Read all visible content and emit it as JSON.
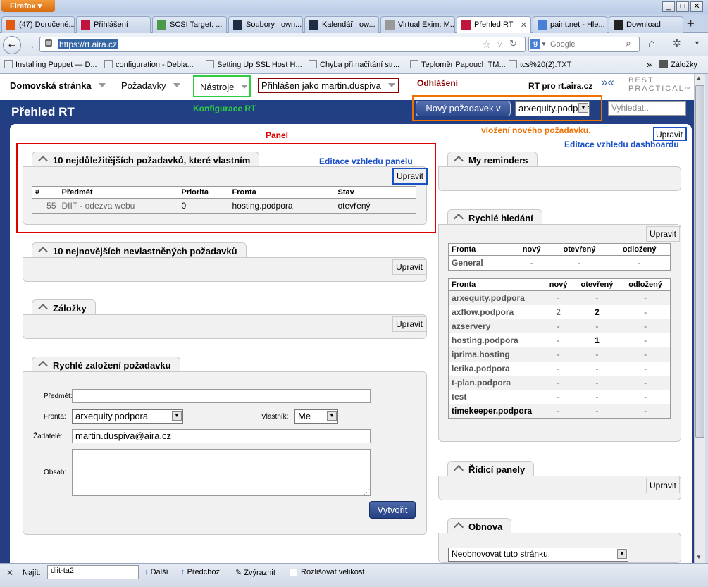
{
  "browser": {
    "menu_button": "Firefox",
    "window_buttons": [
      "_",
      "□",
      "✕"
    ],
    "tabs": [
      {
        "label": "(47) Doručené...",
        "icon": "mail-icon",
        "color": "#e05a14"
      },
      {
        "label": "Přihlášení",
        "icon": "check-icon",
        "color": "#c0143c"
      },
      {
        "label": "SCSI Target: ...",
        "icon": "gear-icon",
        "color": "#4a9a4a"
      },
      {
        "label": "Soubory | own...",
        "icon": "cloud-icon",
        "color": "#1d2d44"
      },
      {
        "label": "Kalendář | ow...",
        "icon": "cloud-icon",
        "color": "#1d2d44"
      },
      {
        "label": "Virtual Exim: M...",
        "icon": "blank-icon",
        "color": "#999999"
      },
      {
        "label": "Přehled RT",
        "icon": "check-icon",
        "color": "#c0143c",
        "active": true
      },
      {
        "label": "paint.net - Hle...",
        "icon": "google-icon",
        "color": "#4a7fd8"
      },
      {
        "label": "Download",
        "icon": "dot-icon",
        "color": "#222222"
      }
    ],
    "new_tab": "+",
    "url": "https://rt.aira.cz",
    "search_placeholder": "Google",
    "bookmarks": [
      {
        "label": "Installing Puppet — D...",
        "icon": "puppet-icon"
      },
      {
        "label": "configuration - Debia...",
        "icon": "debian-icon"
      },
      {
        "label": "Setting Up SSL Host H...",
        "icon": "wiki-icon"
      },
      {
        "label": "Chyba při načítání str...",
        "icon": "blank-icon"
      },
      {
        "label": "Teploměr Papouch TM...",
        "icon": "thermo-icon"
      },
      {
        "label": "tcs%20(2).TXT",
        "icon": "blank-icon"
      }
    ],
    "bookmarks_more": "»",
    "bookmarks_folder": "Záložky"
  },
  "rt": {
    "nav": {
      "home": "Domovská stránka",
      "tickets": "Požadavky",
      "tools": "Nástroje",
      "logged_in": "Přihlášen jako martin.duspiva"
    },
    "brand": "RT pro rt.aira.cz",
    "logo_line1": "BEST",
    "logo_line2": "PRACTICAL",
    "logo_tm": "™",
    "page_title": "Přehled RT",
    "new_ticket_button": "Nový požadavek v",
    "new_ticket_queue": "arxequity.podpora",
    "search_placeholder": "Vyhledat...",
    "dashboard_edit": "Upravit"
  },
  "annotations": {
    "logout": "Odhlášení",
    "rt_config": "Konfigurace RT",
    "panel": "Panel",
    "new_ticket": "vložení nového požadavku.",
    "dashboard_edit": "Editace vzhledu dashboardu",
    "panel_edit": "Editace vzhledu panelu"
  },
  "colors": {
    "logout_red": "#8b0000",
    "config_green": "#2ecc40",
    "panel_red": "#e00000",
    "orange": "#f07000",
    "blue_note": "#1a4fc8",
    "rt_blue": "#253e82"
  },
  "boxes": {
    "my_tickets": {
      "title": "10 nejdůležitějších požadavků, které vlastním",
      "edit": "Upravit",
      "columns": [
        "#",
        "Předmět",
        "Priorita",
        "Fronta",
        "Stav"
      ],
      "rows": [
        [
          "55",
          "DIIT - odezva webu",
          "0",
          "hosting.podpora",
          "otevřený"
        ]
      ]
    },
    "unowned": {
      "title": "10 nejnovějších nevlastněných požadavků",
      "edit": "Upravit"
    },
    "bookmarks": {
      "title": "Záložky",
      "edit": "Upravit"
    },
    "quick_create": {
      "title": "Rychlé založení požadavku",
      "subject_label": "Předmět:",
      "subject_value": "",
      "queue_label": "Fronta:",
      "queue_value": "arxequity.podpora",
      "owner_label": "Vlastník:",
      "owner_value": "Me",
      "requestors_label": "Žadatelé:",
      "requestors_value": "martin.duspiva@aira.cz",
      "content_label": "Obsah:",
      "create_button": "Vytvořit"
    },
    "reminders": {
      "title": "My reminders"
    },
    "quick_search": {
      "title": "Rychlé hledání",
      "edit": "Upravit",
      "general_columns": [
        "Fronta",
        "nový",
        "otevřený",
        "odložený"
      ],
      "general_rows": [
        [
          "General",
          "-",
          "-",
          "-"
        ]
      ],
      "queue_columns": [
        "Fronta",
        "nový",
        "otevřený",
        "odložený"
      ],
      "queue_rows": [
        [
          "arxequity.podpora",
          "-",
          "-",
          "-"
        ],
        [
          "axflow.podpora",
          "2",
          "2",
          "-"
        ],
        [
          "azservery",
          "-",
          "-",
          "-"
        ],
        [
          "hosting.podpora",
          "-",
          "1",
          "-"
        ],
        [
          "iprima.hosting",
          "-",
          "-",
          "-"
        ],
        [
          "lerika.podpora",
          "-",
          "-",
          "-"
        ],
        [
          "t-plan.podpora",
          "-",
          "-",
          "-"
        ],
        [
          "test",
          "-",
          "-",
          "-"
        ],
        [
          "timekeeper.podpora",
          "-",
          "-",
          "-"
        ]
      ]
    },
    "dashboards": {
      "title": "Řídicí panely",
      "edit": "Upravit"
    },
    "refresh": {
      "title": "Obnova",
      "value": "Neobnovovat tuto stránku."
    }
  },
  "findbar": {
    "close": "✕",
    "label": "Najít:",
    "value": "diit-ta2",
    "next": "Další",
    "prev": "Předchozí",
    "highlight": "Zvýraznit",
    "match_case": "Rozlišovat velikost"
  }
}
